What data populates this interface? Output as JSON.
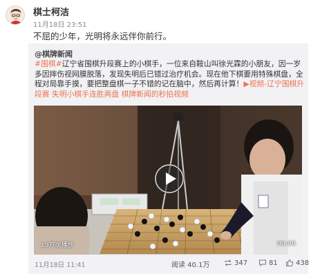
{
  "post": {
    "user_name": "棋士柯洁",
    "time": "11月18日 23:51",
    "text": "不屈的少年，光明将永远伴你前行。"
  },
  "repost": {
    "author": "@棋牌新闻",
    "tag": "#围棋#",
    "body": "辽宁省围棋升段赛上的小棋手，一位来自鞍山叫徐光霖的小朋友，因一岁多因摔伤视网膜脱落，发现失明后已错过治疗机会。现在他下棋要用特殊棋盘，全程对局靠手摸，要把整盘棋一子不错的记在脑中，然后再计算！",
    "video_link": "视频-辽宁围棋升段赛 失明小棋手连胜两盘",
    "source_link": "棋牌新闻的秒拍视频",
    "video": {
      "views": "19万次播放",
      "duration": "00:09"
    },
    "time": "11月18日 11:41",
    "stats": {
      "read": "阅读 40.1万",
      "reposts": "347",
      "comments": "81",
      "likes": "438"
    }
  },
  "colors": {
    "link": "#eb7350",
    "background": "#ffffff",
    "repost_background": "#f2f2f5"
  }
}
